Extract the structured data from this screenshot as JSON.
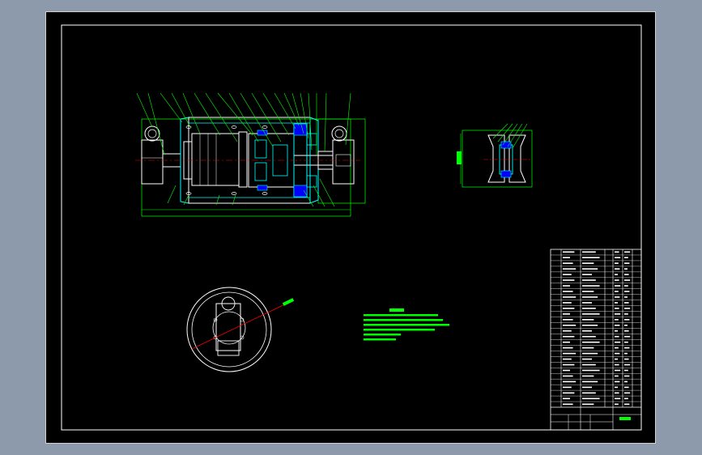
{
  "colors": {
    "background_viewport": "#8c9aab",
    "sheet": "#000000",
    "frame": "#ffffff",
    "outline": "#ffffff",
    "leader": "#00ff00",
    "section": "#00ffff",
    "hatch": "#0000ff",
    "center_line": "#ff0000",
    "dimension": "#00ff00",
    "dim_text": "#00ff00",
    "table_text": "#ffffff"
  },
  "icons": [
    "balloon-leader",
    "center-line",
    "section-hatch",
    "title-block"
  ]
}
